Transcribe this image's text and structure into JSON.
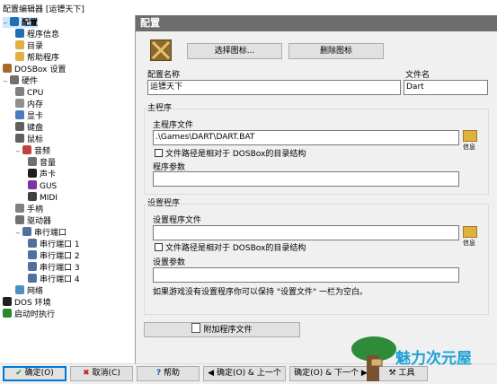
{
  "window": {
    "title": "配置编辑器 [运镖天下]"
  },
  "tree": [
    {
      "label": "配置",
      "level": 0,
      "expander": "−",
      "icon": "gear-icon",
      "selected": true
    },
    {
      "label": "程序信息",
      "level": 1,
      "icon": "info-icon"
    },
    {
      "label": "目录",
      "level": 1,
      "icon": "folder-icon"
    },
    {
      "label": "帮助程序",
      "level": 1,
      "icon": "folder-icon"
    },
    {
      "label": "DOSBox 设置",
      "level": 0,
      "icon": "dosbox-icon"
    },
    {
      "label": "硬件",
      "level": 0,
      "expander": "−",
      "icon": "hardware-icon"
    },
    {
      "label": "CPU",
      "level": 1,
      "icon": "cpu-icon"
    },
    {
      "label": "内存",
      "level": 1,
      "icon": "memory-icon"
    },
    {
      "label": "显卡",
      "level": 1,
      "icon": "graphics-icon"
    },
    {
      "label": "键盘",
      "level": 1,
      "icon": "keyboard-icon"
    },
    {
      "label": "鼠标",
      "level": 1,
      "icon": "mouse-icon"
    },
    {
      "label": "音频",
      "level": 1,
      "expander": "−",
      "icon": "speaker-icon"
    },
    {
      "label": "音量",
      "level": 2,
      "icon": "volume-icon"
    },
    {
      "label": "声卡",
      "level": 2,
      "icon": "sb-icon"
    },
    {
      "label": "GUS",
      "level": 2,
      "icon": "gus-icon"
    },
    {
      "label": "MIDI",
      "level": 2,
      "icon": "midi-icon"
    },
    {
      "label": "手柄",
      "level": 1,
      "icon": "joystick-icon"
    },
    {
      "label": "驱动器",
      "level": 1,
      "icon": "drive-icon"
    },
    {
      "label": "串行端口",
      "level": 1,
      "expander": "−",
      "icon": "serial-icon"
    },
    {
      "label": "串行端口 1",
      "level": 2,
      "icon": "serial-port-icon"
    },
    {
      "label": "串行端口 2",
      "level": 2,
      "icon": "serial-port-icon"
    },
    {
      "label": "串行端口 3",
      "level": 2,
      "icon": "serial-port-icon"
    },
    {
      "label": "串行端口 4",
      "level": 2,
      "icon": "serial-port-icon"
    },
    {
      "label": "网络",
      "level": 1,
      "icon": "network-icon"
    },
    {
      "label": "DOS 环境",
      "level": 0,
      "icon": "dos-icon"
    },
    {
      "label": "启动时执行",
      "level": 0,
      "icon": "autoexec-icon"
    }
  ],
  "panel": {
    "header": "配置",
    "select_icon": "选择图标...",
    "delete_icon": "删除图标",
    "profile_name_label": "配置名称",
    "profile_name": "运镖天下",
    "filename_label": "文件名",
    "filename": "Dart",
    "main_group": "主程序",
    "main_file_label": "主程序文件",
    "main_file": ".\\Games\\DART\\DART.BAT",
    "relative_label": "文件路径是相对于 DOSBox的目录结构",
    "info": "信息",
    "params_label": "程序参数",
    "params": "",
    "setup_group": "设置程序",
    "setup_file_label": "设置程序文件",
    "setup_file": "",
    "setup_relative_label": "文件路径是相对于 DOSBox的目录结构",
    "setup_params_label": "设置参数",
    "setup_params": "",
    "note": "如果游戏没有设置程序你可以保持 \"设置文件\" 一栏为空白。",
    "add_file": "附加程序文件"
  },
  "bottom": {
    "ok": "确定(O)",
    "cancel": "取消(C)",
    "help": "帮助",
    "ok_prev": "确定(O) & 上一个",
    "ok_next": "确定(O) & 下一个",
    "tools": "工具"
  },
  "watermark": "魅力次元屋"
}
